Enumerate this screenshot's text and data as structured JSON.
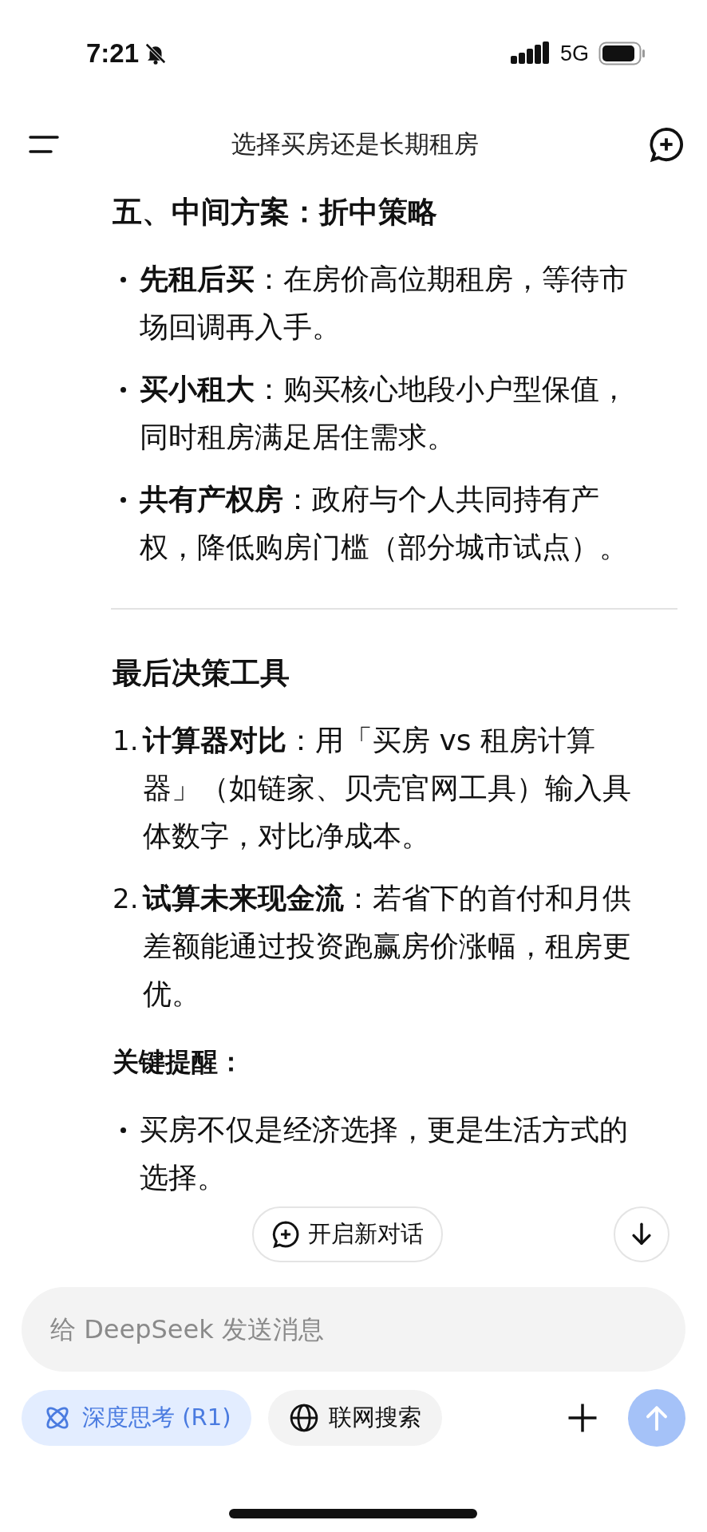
{
  "status_bar": {
    "time": "7:21",
    "network": "5G"
  },
  "header": {
    "title": "选择买房还是长期租房"
  },
  "content": [
    {
      "kind": "heading",
      "text": "五、中间方案：折中策略"
    },
    {
      "kind": "bullets",
      "items": [
        "**先租后买**：在房价高位期租房，等待市场回调再入手。",
        "**买小租大**：购买核心地段小户型保值，同时租房满足居住需求。",
        "**共有产权房**：政府与个人共同持有产权，降低购房门槛（部分城市试点）。"
      ]
    },
    {
      "kind": "divider"
    },
    {
      "kind": "heading",
      "text": "最后决策工具"
    },
    {
      "kind": "numbered",
      "items": [
        {
          "number": "1.",
          "text": "**计算器对比**：用「买房 vs 租房计算器」（如链家、贝壳官网工具）输入具体数字，对比净成本。"
        },
        {
          "number": "2.",
          "text": "**试算未来现金流**：若省下的首付和月供差额能通过投资跑赢房价涨幅，租房更优。"
        }
      ]
    },
    {
      "kind": "label",
      "text": "关键提醒："
    },
    {
      "kind": "bullets",
      "items": [
        "买房不仅是经济选择，更是生活方式的选择。"
      ]
    }
  ],
  "new_chat_button": {
    "label": "开启新对话"
  },
  "composer": {
    "placeholder": "给 DeepSeek 发送消息"
  },
  "options": [
    {
      "label": "深度思考 (R1)",
      "kind": "think",
      "selected": true
    },
    {
      "label": "联网搜索",
      "kind": "search",
      "selected": false
    }
  ]
}
